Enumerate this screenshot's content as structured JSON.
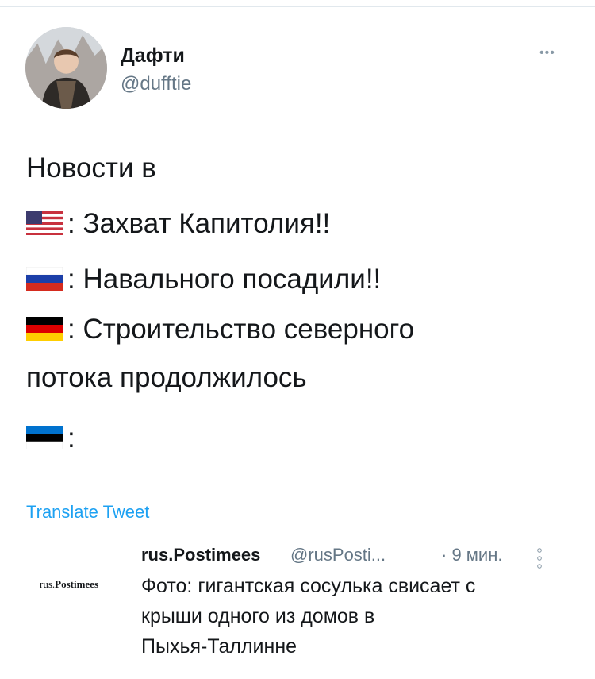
{
  "author": {
    "display_name": "Дафти",
    "handle": "@dufftie"
  },
  "tweet": {
    "line1": "Новости в",
    "items": [
      {
        "flag": "flag-usa-icon",
        "text": ": Захват Капитолия!!"
      },
      {
        "flag": "flag-russia-icon",
        "text": ": Навального посадили!!"
      },
      {
        "flag": "flag-germany-icon",
        "text": ": Строительство северного"
      },
      {
        "flag": "",
        "text": "потока продолжилось"
      },
      {
        "flag": "flag-estonia-icon",
        "text": ":"
      }
    ]
  },
  "translate_label": "Translate Tweet",
  "quoted": {
    "logo_prefix": "rus.",
    "logo_brand": "Postimees",
    "author": "rus.Postimees",
    "handle": "@rusPosti...",
    "time": "· 9 мин.",
    "text_lines": [
      "Фото: гигантская сосулька свисает с",
      "крыши одного из домов в",
      "Пыхья-Таллинне"
    ]
  },
  "colors": {
    "link": "#1da1f2",
    "muted": "#657786",
    "text": "#14171a"
  }
}
